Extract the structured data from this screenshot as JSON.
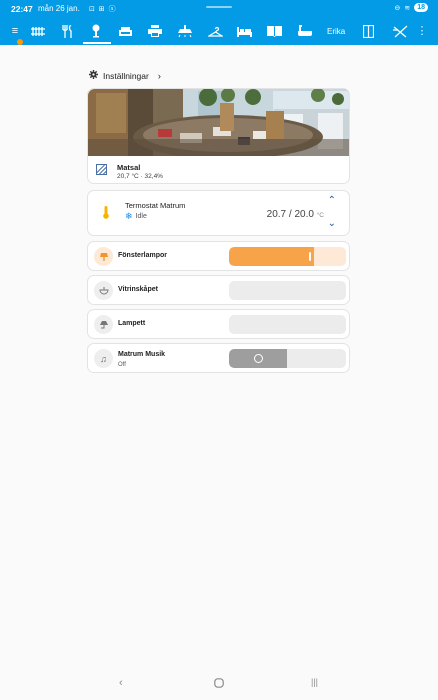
{
  "status": {
    "time": "22:47",
    "date": "mån 26 jan.",
    "left_icons": "⊡ ⊞ ⓢ",
    "right_icons": [
      "minus-circle-icon",
      "wifi-icon"
    ],
    "battery": "18"
  },
  "nav": {
    "user_label": "Erika",
    "icons": [
      "menu-icon",
      "radiator-icon",
      "silverware-icon",
      "lamp-icon",
      "sofa-icon",
      "printer-icon",
      "ceiling-light-icon",
      "hanger-icon",
      "bed-icon",
      "book-icon",
      "bathtub-icon",
      "wardrobe-icon",
      "tools-icon",
      "more-icon"
    ],
    "active": "lamp-icon"
  },
  "settings": {
    "label": "Inställningar"
  },
  "area": {
    "name": "Matsal",
    "stats": "20,7 °C · 32,4%"
  },
  "thermostat": {
    "name": "Termostat Matrum",
    "state": "Idle",
    "temp": "20.7 / 20.0",
    "unit": "°C"
  },
  "controls": [
    {
      "name": "Fönsterlampor",
      "level": 0.73,
      "on": true
    },
    {
      "name": "Vitrinskåpet",
      "level": 0,
      "on": false
    },
    {
      "name": "Lampett",
      "level": 0,
      "on": false
    }
  ],
  "media": {
    "name": "Matrum Musik",
    "state": "Off"
  },
  "colors": {
    "header": "#039be5",
    "accent_orange": "#f7a34a",
    "light_on_bg": "#fde9d6"
  }
}
